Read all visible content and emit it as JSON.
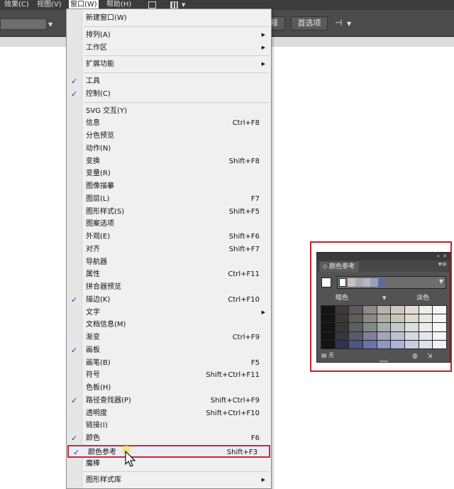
{
  "menubar": {
    "items": [
      "效果(C)",
      "视图(V)",
      "窗口(W)",
      "帮助(H)"
    ],
    "active_index": 2
  },
  "controlbar": {
    "button1": "选择",
    "button2": "首选项",
    "pin_icon": "pin-icon"
  },
  "window_menu": {
    "items": [
      {
        "label": "新建窗口(W)",
        "shortcut": "",
        "checked": false,
        "submenu": false
      },
      {
        "sep": true
      },
      {
        "label": "排列(A)",
        "shortcut": "",
        "checked": false,
        "submenu": true
      },
      {
        "label": "工作区",
        "shortcut": "",
        "checked": false,
        "submenu": true
      },
      {
        "sep": true
      },
      {
        "label": "扩展功能",
        "shortcut": "",
        "checked": false,
        "submenu": true
      },
      {
        "sep": true
      },
      {
        "label": "工具",
        "shortcut": "",
        "checked": true,
        "submenu": false
      },
      {
        "label": "控制(C)",
        "shortcut": "",
        "checked": true,
        "submenu": false
      },
      {
        "sep": true
      },
      {
        "label": "SVG 交互(Y)",
        "shortcut": "",
        "checked": false,
        "submenu": false
      },
      {
        "label": "信息",
        "shortcut": "Ctrl+F8",
        "checked": false,
        "submenu": false
      },
      {
        "label": "分色预览",
        "shortcut": "",
        "checked": false,
        "submenu": false
      },
      {
        "label": "动作(N)",
        "shortcut": "",
        "checked": false,
        "submenu": false
      },
      {
        "label": "变换",
        "shortcut": "Shift+F8",
        "checked": false,
        "submenu": false
      },
      {
        "label": "变量(R)",
        "shortcut": "",
        "checked": false,
        "submenu": false
      },
      {
        "label": "图像描摹",
        "shortcut": "",
        "checked": false,
        "submenu": false
      },
      {
        "label": "图层(L)",
        "shortcut": "F7",
        "checked": false,
        "submenu": false
      },
      {
        "label": "图形样式(S)",
        "shortcut": "Shift+F5",
        "checked": false,
        "submenu": false
      },
      {
        "label": "图案选项",
        "shortcut": "",
        "checked": false,
        "submenu": false
      },
      {
        "label": "外观(E)",
        "shortcut": "Shift+F6",
        "checked": false,
        "submenu": false
      },
      {
        "label": "对齐",
        "shortcut": "Shift+F7",
        "checked": false,
        "submenu": false
      },
      {
        "label": "导航器",
        "shortcut": "",
        "checked": false,
        "submenu": false
      },
      {
        "label": "属性",
        "shortcut": "Ctrl+F11",
        "checked": false,
        "submenu": false
      },
      {
        "label": "拼合器预览",
        "shortcut": "",
        "checked": false,
        "submenu": false
      },
      {
        "label": "描边(K)",
        "shortcut": "Ctrl+F10",
        "checked": true,
        "submenu": false
      },
      {
        "label": "文字",
        "shortcut": "",
        "checked": false,
        "submenu": true
      },
      {
        "label": "文档信息(M)",
        "shortcut": "",
        "checked": false,
        "submenu": false
      },
      {
        "label": "渐变",
        "shortcut": "Ctrl+F9",
        "checked": false,
        "submenu": false
      },
      {
        "label": "画板",
        "shortcut": "",
        "checked": true,
        "submenu": false
      },
      {
        "label": "画笔(B)",
        "shortcut": "F5",
        "checked": false,
        "submenu": false
      },
      {
        "label": "符号",
        "shortcut": "Shift+Ctrl+F11",
        "checked": false,
        "submenu": false
      },
      {
        "label": "色板(H)",
        "shortcut": "",
        "checked": false,
        "submenu": false
      },
      {
        "label": "路径查找器(P)",
        "shortcut": "Shift+Ctrl+F9",
        "checked": true,
        "submenu": false
      },
      {
        "label": "透明度",
        "shortcut": "Shift+Ctrl+F10",
        "checked": false,
        "submenu": false
      },
      {
        "label": "链接(I)",
        "shortcut": "",
        "checked": false,
        "submenu": false
      },
      {
        "label": "颜色",
        "shortcut": "F6",
        "checked": true,
        "submenu": false
      },
      {
        "label": "颜色参考",
        "shortcut": "Shift+F3",
        "checked": true,
        "submenu": false,
        "highlighted": true
      },
      {
        "label": "魔棒",
        "shortcut": "",
        "checked": false,
        "submenu": false
      },
      {
        "sep": true
      },
      {
        "label": "图形样式库",
        "shortcut": "",
        "checked": false,
        "submenu": true
      }
    ],
    "check_glyph": "✓",
    "arrow_glyph": "▶"
  },
  "color_guide": {
    "tab_label": "颜色参考",
    "collapse_glyph": "«",
    "close_glyph": "✕",
    "menu_glyph": "▾≡",
    "left_label": "暗色",
    "right_label": "淡色",
    "bottom_label": "无",
    "current_color": "#ffffff",
    "harmony_colors": [
      "#c9c0b8",
      "#a9aab8",
      "#b7b5c6",
      "#9b9fb8",
      "#5f6aa0"
    ],
    "grid_colors": [
      [
        "#141414",
        "#3a3a3a",
        "#5a5a5a",
        "#8c8c8c",
        "#b8b2ad",
        "#d0c8c0",
        "#e4ddd6",
        "#ededed",
        "#f5f5f5"
      ],
      [
        "#141414",
        "#3b3834",
        "#625c58",
        "#8e8882",
        "#b2aca6",
        "#cbc4bd",
        "#dfd9d2",
        "#ebe7e2",
        "#f6f4f2"
      ],
      [
        "#141414",
        "#333835",
        "#5a615d",
        "#808a85",
        "#a5b0aa",
        "#c2cbc6",
        "#d9e0dc",
        "#e9eeeb",
        "#f4f7f5"
      ],
      [
        "#141414",
        "#363640",
        "#58596a",
        "#7e8096",
        "#a3a5bb",
        "#bec0d2",
        "#d6d8e4",
        "#e6e7ef",
        "#f3f3f8"
      ],
      [
        "#141414",
        "#2f3250",
        "#4d5383",
        "#6a72aa",
        "#8e96c4",
        "#aeb4d6",
        "#c9cde4",
        "#dfe1ef",
        "#eef0f7"
      ]
    ]
  }
}
